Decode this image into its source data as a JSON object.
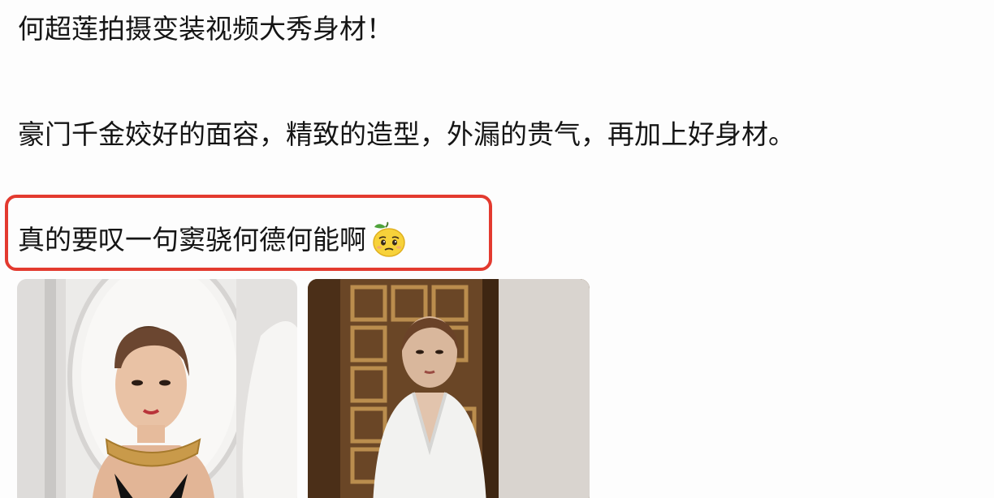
{
  "post": {
    "line1": "何超莲拍摄变装视频大秀身材！",
    "line2": "豪门千金姣好的面容，精致的造型，外漏的贵气，再加上好身材。",
    "line3": "真的要叹一句窦骁何德何能啊"
  },
  "emoji": {
    "icon": "lemon-face-emoji"
  },
  "colors": {
    "highlight": "#e33a2f"
  }
}
